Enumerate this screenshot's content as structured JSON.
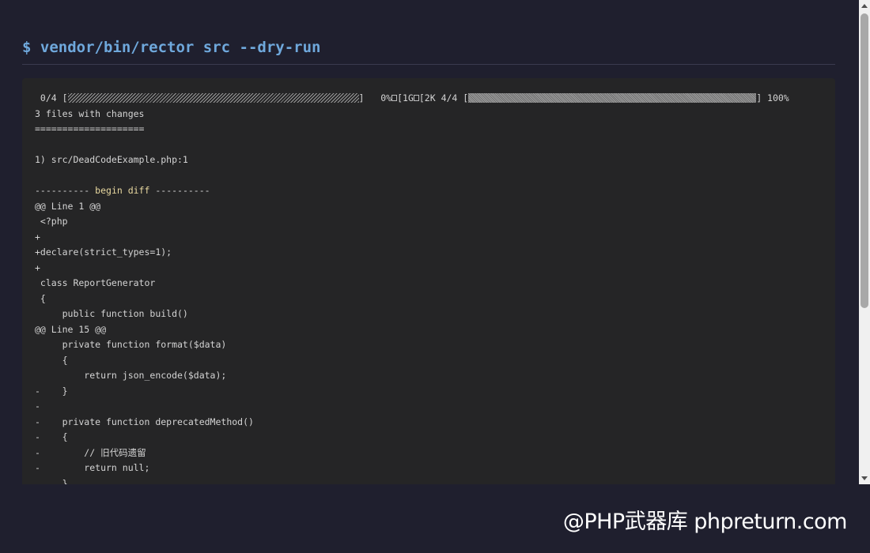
{
  "header": {
    "command": "$ vendor/bin/rector src --dry-run"
  },
  "terminal": {
    "progress": {
      "initial_counter": " 0/4 [",
      "initial_bar_close": "]   0%",
      "escape_seq_1": "[1G",
      "escape_seq_2": "[2K 4/4 [",
      "final_bar_close": "] 100%",
      "initial_percent": 0,
      "final_percent": 100
    },
    "lines": [
      "3 files with changes",
      "====================",
      "",
      "1) src/DeadCodeExample.php:1",
      "",
      "",
      "@@ Line 1 @@",
      " <?php",
      "+",
      "+declare(strict_types=1);",
      "+",
      " class ReportGenerator",
      " {",
      "     public function build()",
      "@@ Line 15 @@",
      "     private function format($data)",
      "     {",
      "         return json_encode($data);",
      "-    }",
      "-",
      "-    private function deprecatedMethod()",
      "-    {",
      "-        // 旧代码遗留",
      "-        return null;",
      "     }"
    ],
    "diff_start": {
      "prefix": "---------- ",
      "label": "begin diff",
      "suffix": " ----------"
    }
  },
  "watermark": {
    "text": "@PHP武器库 phpreturn.com"
  },
  "colors": {
    "page_background": "#1f1f2e",
    "terminal_background": "#252526",
    "command_color": "#6fa8dc",
    "output_text": "#d4d4d4",
    "diff_label": "#e8d8a0"
  }
}
